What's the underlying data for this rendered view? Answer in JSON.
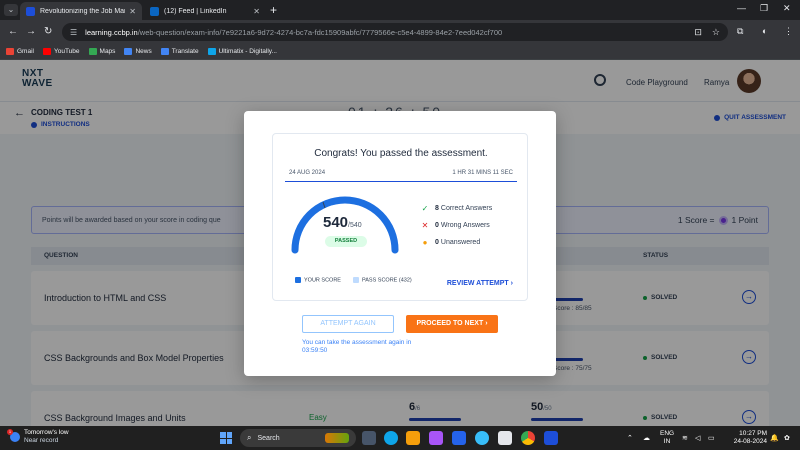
{
  "browser": {
    "tabs": [
      {
        "title": "Revolutionizing the Job Market",
        "active": true,
        "favicon_color": "#1d4ed8"
      },
      {
        "title": "(12) Feed | LinkedIn",
        "active": false,
        "favicon_color": "#0a66c2"
      }
    ],
    "url_host": "learning.ccbp.in",
    "url_path": "/web-question/exam-info/7e9221a6-9d72-4274-bc7a-fdc15909abfc/7779566e-c5e4-4899-84e2-7eed042cf700",
    "bookmarks": [
      {
        "label": "Gmail",
        "color": "#ea4335"
      },
      {
        "label": "YouTube",
        "color": "#ff0000"
      },
      {
        "label": "Maps",
        "color": "#34a853"
      },
      {
        "label": "News",
        "color": "#4285f4"
      },
      {
        "label": "Translate",
        "color": "#4285f4"
      },
      {
        "label": "Ultimatix - Digitally...",
        "color": "#0ea5e9"
      }
    ]
  },
  "app": {
    "logo_line1": "NXT",
    "logo_line2": "WAVE",
    "code_playground": "Code Playground",
    "user_name": "Ramya",
    "test_title": "CODING TEST 1",
    "instructions": "INSTRUCTIONS",
    "quit": "QUIT ASSESSMENT",
    "clock_peek": "01 : 26 : 50",
    "points_text": "Points will be awarded based on your score in coding que",
    "score_rule_left": "1 Score =",
    "score_rule_right": "1 Point",
    "table_headers": {
      "question": "QUESTION",
      "status": "STATUS"
    },
    "rows": [
      {
        "question": "Introduction to HTML and CSS",
        "difficulty": "",
        "score_a": "",
        "score_a_max": "",
        "score_b": "",
        "score_b_max": "5",
        "sub_score": "Score : 85/85",
        "status": "SOLVED"
      },
      {
        "question": "CSS Backgrounds and Box Model Properties",
        "difficulty": "",
        "score_a": "",
        "score_a_max": "",
        "score_b": "",
        "score_b_max": "5",
        "sub_score": "Score : 75/75",
        "status": "SOLVED"
      },
      {
        "question": "CSS Background Images and Units",
        "difficulty": "Easy",
        "score_a": "6",
        "score_a_max": "/6",
        "score_b": "50",
        "score_b_max": "/50",
        "sub_score": "",
        "status": "SOLVED"
      }
    ]
  },
  "modal": {
    "title": "Congrats! You passed the assessment.",
    "date": "24 AUG 2024",
    "duration": "1 HR 31 MINS 11 SEC",
    "score": "540",
    "score_max": "/540",
    "score_fraction": 1.0,
    "result": "PASSED",
    "stats": [
      {
        "count": "8",
        "label": "Correct Answers",
        "icon": "check-icon",
        "color": "#16a34a"
      },
      {
        "count": "0",
        "label": "Wrong Answers",
        "icon": "cross-icon",
        "color": "#dc2626"
      },
      {
        "count": "0",
        "label": "Unanswered",
        "icon": "dot-icon",
        "color": "#f59e0b"
      }
    ],
    "legend_your_score": "YOUR SCORE",
    "legend_pass_score": "PASS SCORE (432)",
    "review": "REVIEW ATTEMPT",
    "attempt_again": "ATTEMPT AGAIN",
    "proceed": "PROCEED TO NEXT",
    "retake_note": "You can take the assessment again in 03:59:50"
  },
  "taskbar": {
    "weather_title": "Tomorrow's low",
    "weather_sub": "Near record",
    "weather_badge": "1",
    "search": "Search",
    "lang_1": "ENG",
    "lang_2": "IN",
    "time": "10:27 PM",
    "date": "24-08-2024"
  },
  "colors": {
    "accent_blue": "#1d4ed8",
    "orange": "#f97316",
    "passed_green": "#15803d"
  }
}
